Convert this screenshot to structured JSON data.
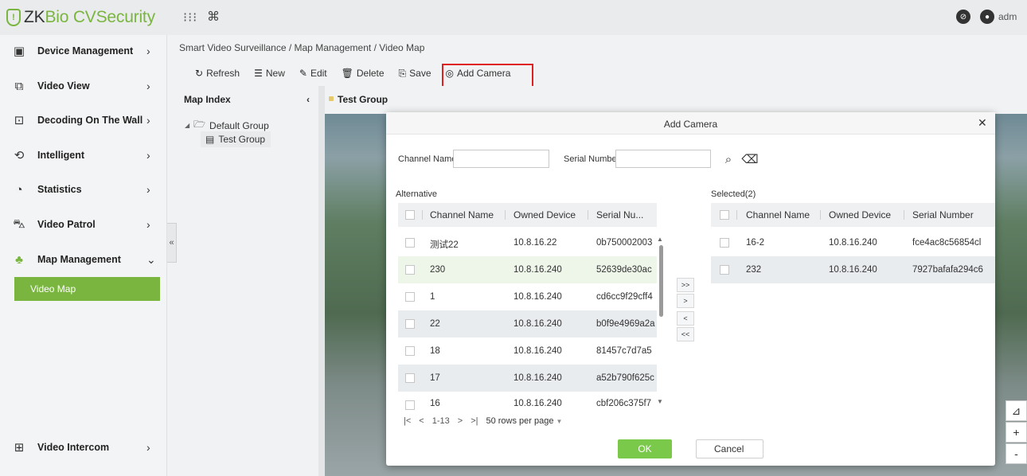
{
  "app": {
    "logo_prefix": "ZK",
    "logo_mid": "Bio",
    "logo_suffix": " CVSecurity",
    "user": "adm"
  },
  "sidebar": {
    "items": [
      {
        "label": "Device Management",
        "icon": "device-icon"
      },
      {
        "label": "Video View",
        "icon": "video-view-icon"
      },
      {
        "label": "Decoding On The Wall",
        "icon": "decoding-icon"
      },
      {
        "label": "Intelligent",
        "icon": "intelligent-icon"
      },
      {
        "label": "Statistics",
        "icon": "statistics-icon"
      },
      {
        "label": "Video Patrol",
        "icon": "patrol-icon"
      },
      {
        "label": "Map Management",
        "icon": "map-icon"
      },
      {
        "label": "Video Intercom",
        "icon": "intercom-icon"
      }
    ],
    "active_sub": "Video Map"
  },
  "breadcrumb": "Smart Video Surveillance / Map Management / Video Map",
  "toolbar": {
    "refresh": "Refresh",
    "new": "New",
    "edit": "Edit",
    "delete": "Delete",
    "save": "Save",
    "add_camera": "Add Camera"
  },
  "map_index": {
    "title": "Map Index",
    "root": "Default Group",
    "child": "Test Group"
  },
  "map_header": "Test Group",
  "dialog": {
    "title": "Add Camera",
    "channel_name_label": "Channel Name",
    "serial_number_label": "Serial Number",
    "alternative_label": "Alternative",
    "selected_label": "Selected(2)",
    "left_columns": [
      "Channel Name",
      "Owned Device",
      "Serial Nu..."
    ],
    "right_columns": [
      "Channel Name",
      "Owned Device",
      "Serial Number"
    ],
    "left_rows": [
      {
        "name": "测试22",
        "device": "10.8.16.22",
        "serial": "0b750002003"
      },
      {
        "name": "230",
        "device": "10.8.16.240",
        "serial": "52639de30ac"
      },
      {
        "name": "1",
        "device": "10.8.16.240",
        "serial": "cd6cc9f29cff4"
      },
      {
        "name": "22",
        "device": "10.8.16.240",
        "serial": "b0f9e4969a2a"
      },
      {
        "name": "18",
        "device": "10.8.16.240",
        "serial": "81457c7d7a5"
      },
      {
        "name": "17",
        "device": "10.8.16.240",
        "serial": "a52b790f625c"
      },
      {
        "name": "16",
        "device": "10.8.16.240",
        "serial": "cbf206c375f7"
      }
    ],
    "right_rows": [
      {
        "name": "16-2",
        "device": "10.8.16.240",
        "serial": "fce4ac8c56854cl"
      },
      {
        "name": "232",
        "device": "10.8.16.240",
        "serial": "7927bafafa294c6"
      }
    ],
    "transfer": {
      "all_right": ">>",
      "right": ">",
      "left": "<",
      "all_left": "<<"
    },
    "pager": {
      "first": "|<",
      "prev": "<",
      "range": "1-13",
      "next": ">",
      "last": ">|",
      "rows_per_page": "50 rows per page"
    },
    "ok": "OK",
    "cancel": "Cancel"
  },
  "map_controls": {
    "plus": "+",
    "minus": "-"
  }
}
